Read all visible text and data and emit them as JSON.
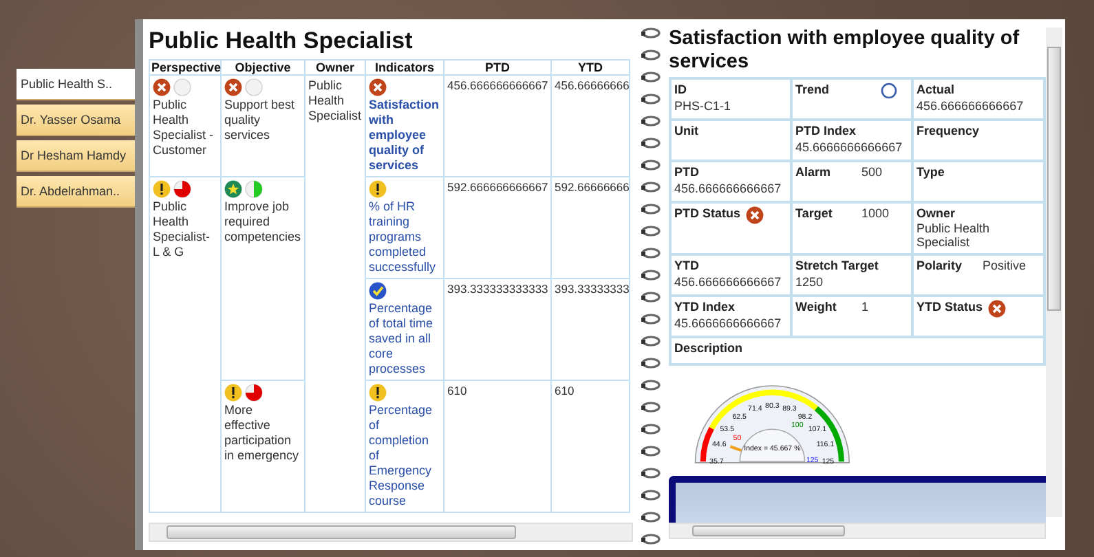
{
  "tabs": [
    {
      "label": "Public Health S..",
      "selected": true
    },
    {
      "label": "Dr. Yasser Osama",
      "selected": false
    },
    {
      "label": "Dr Hesham Hamdy",
      "selected": false
    },
    {
      "label": "Dr. Abdelrahman..",
      "selected": false
    }
  ],
  "page_title": "Public Health Specialist",
  "table": {
    "columns": [
      "Perspective",
      "Objective",
      "Owner",
      "Indicators",
      "PTD",
      "YTD"
    ],
    "owner": "Public Health Specialist",
    "perspectives": [
      {
        "status": {
          "kind": "cross"
        },
        "trend": {
          "kind": "empty"
        },
        "name": "Public Health Specialist - Customer",
        "objectives": [
          {
            "status": {
              "kind": "cross"
            },
            "trend": {
              "kind": "empty"
            },
            "name": "Support best quality services",
            "indicators": [
              {
                "status": {
                  "kind": "cross"
                },
                "name": "Satisfaction with employee quality of services",
                "selected": true,
                "ptd": "456.666666666667",
                "ytd": "456.66666666"
              }
            ]
          }
        ]
      },
      {
        "status": {
          "kind": "warning"
        },
        "trend": {
          "kind": "three_quarters",
          "color": "#e00000"
        },
        "name": "Public Health Specialist- L & G",
        "objectives": [
          {
            "status": {
              "kind": "star"
            },
            "trend": {
              "kind": "half",
              "color": "#22cc22"
            },
            "name": "Improve job required competencies",
            "indicators": [
              {
                "status": {
                  "kind": "warning"
                },
                "name": "% of HR training programs completed successfully",
                "selected": false,
                "ptd": "592.666666666667",
                "ytd": "592.66666666"
              },
              {
                "status": {
                  "kind": "check"
                },
                "name": "Percentage of total time saved in all core processes",
                "selected": false,
                "ptd": "393.333333333333",
                "ytd": "393.33333333"
              }
            ]
          },
          {
            "status": {
              "kind": "warning"
            },
            "trend": {
              "kind": "three_quarters",
              "color": "#e00000"
            },
            "name": "More effective participation in emergency",
            "indicators": [
              {
                "status": {
                  "kind": "warning"
                },
                "name": "Percentage of completion of Emergency Response course",
                "selected": false,
                "ptd": "610",
                "ytd": "610"
              }
            ]
          }
        ]
      }
    ]
  },
  "detail": {
    "title": "Satisfaction with employee quality of services",
    "rows": [
      [
        {
          "kind": "text",
          "label": "ID",
          "value": "PHS-C1-1"
        },
        {
          "kind": "trend",
          "label": "Trend"
        },
        {
          "kind": "text",
          "label": "Actual",
          "value": "456.666666666667"
        }
      ],
      [
        {
          "kind": "text",
          "label": "Unit"
        },
        {
          "kind": "text",
          "label": "PTD Index",
          "value": "45.6666666666667"
        },
        {
          "kind": "text",
          "label": "Frequency"
        }
      ],
      [
        {
          "kind": "text",
          "label": "PTD",
          "value": "456.666666666667"
        },
        {
          "kind": "text",
          "label": "Alarm",
          "value": "500"
        },
        {
          "kind": "text",
          "label": "Type"
        }
      ],
      [
        {
          "kind": "status",
          "label": "PTD Status",
          "status": {
            "kind": "cross"
          }
        },
        {
          "kind": "text",
          "label": "Target",
          "value": "1000"
        },
        {
          "kind": "text",
          "label": "Owner",
          "value": "Public Health Specialist"
        }
      ],
      [
        {
          "kind": "text",
          "label": "YTD",
          "value": "456.666666666667"
        },
        {
          "kind": "text",
          "label": "Stretch Target",
          "value": "1250"
        },
        {
          "kind": "text",
          "label": "Polarity",
          "value": "Positive"
        }
      ],
      [
        {
          "kind": "text",
          "label": "YTD Index",
          "value": "45.6666666666667"
        },
        {
          "kind": "text",
          "label": "Weight",
          "value": "1"
        },
        {
          "kind": "status",
          "label": "YTD Status",
          "status": {
            "kind": "cross"
          }
        }
      ],
      [
        {
          "kind": "wide",
          "label": "Description"
        }
      ]
    ]
  },
  "gauge": {
    "scale": [
      "35.7",
      "44.6",
      "53.5",
      "62.5",
      "71.4",
      "80.3",
      "89.3",
      "98.2",
      "107.1",
      "116.1",
      "125"
    ],
    "markers": [
      "50",
      "100",
      "125"
    ],
    "index_text": "Index = 45.667 %"
  }
}
